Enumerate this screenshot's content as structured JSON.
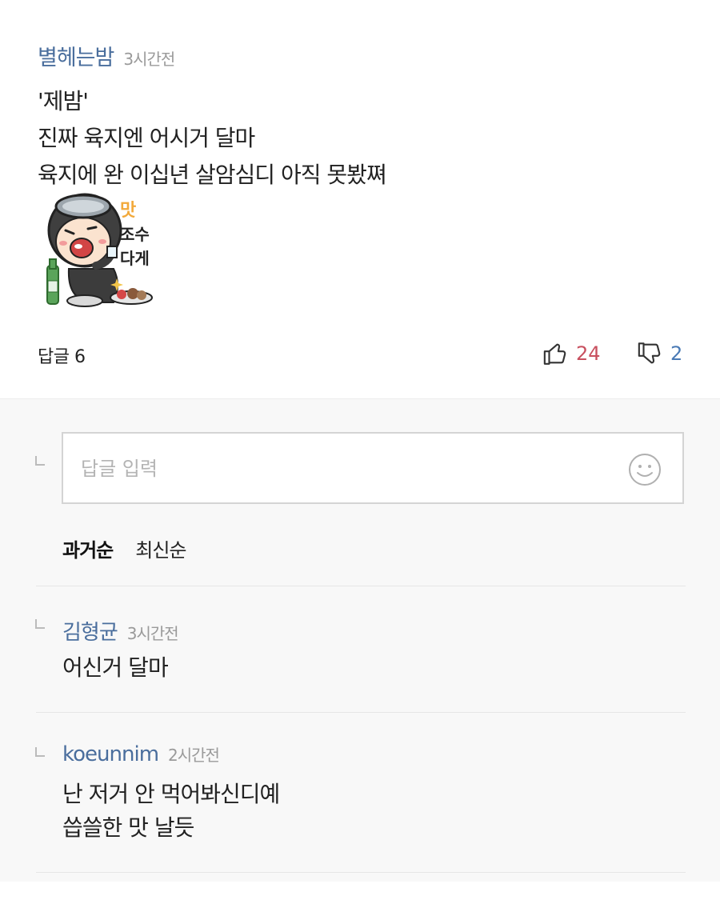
{
  "comment": {
    "author": "별헤는밤",
    "time": "3시간전",
    "lines": [
      "'제밤'",
      "진짜 육지엔 어시거 달마",
      "육지에 완 이십년 살암심디 아직 못봤쪄"
    ],
    "sticker": {
      "name": "diver-eating-sticker",
      "text": [
        "맛",
        "조수",
        "다게"
      ]
    },
    "reply_count_label": "답글 6",
    "likes": "24",
    "dislikes": "2"
  },
  "reply_input": {
    "placeholder": "답글 입력"
  },
  "sort": {
    "oldest": "과거순",
    "newest": "최신순"
  },
  "replies": [
    {
      "author": "김형균",
      "time": "3시간전",
      "lines": [
        "어신거 달마"
      ]
    },
    {
      "author": "koeunnim",
      "time": "2시간전",
      "lines": [
        "난 저거 안 먹어봐신디예",
        "씁쓸한 맛 날듯"
      ]
    }
  ],
  "colors": {
    "author": "#4a6e9d",
    "like": "#c8505f",
    "dislike": "#4a7ab5",
    "reply_bg": "#f8f8f8"
  },
  "icons": [
    "thumbs-up-icon",
    "thumbs-down-icon",
    "smiley-icon",
    "reply-arrow-icon"
  ]
}
